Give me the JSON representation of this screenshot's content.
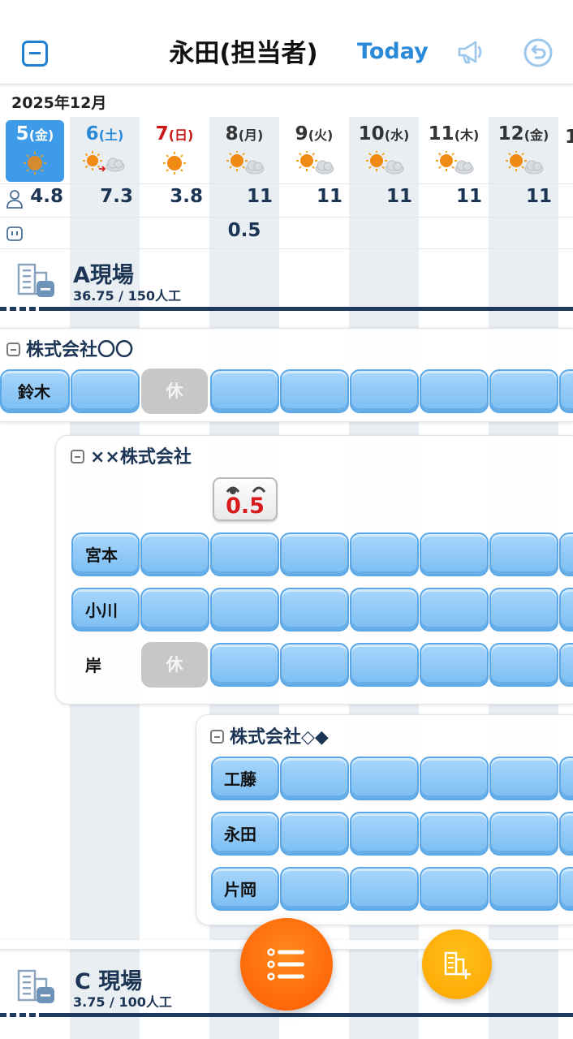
{
  "header": {
    "title": "永田(担当者)",
    "today_label": "Today",
    "collapse_icon": "minus-square-icon",
    "announce_icon": "megaphone-icon",
    "back_icon": "undo-icon"
  },
  "calendar": {
    "month": "2025年12月",
    "days": [
      {
        "num": "5",
        "dow": "(金)",
        "weather": "sunny",
        "workers": "4.8",
        "extra": "",
        "selected": true
      },
      {
        "num": "6",
        "dow": "(土)",
        "weather": "sunny-to-cloudy",
        "workers": "7.3",
        "extra": ""
      },
      {
        "num": "7",
        "dow": "(日)",
        "weather": "sunny",
        "workers": "3.8",
        "extra": ""
      },
      {
        "num": "8",
        "dow": "(月)",
        "weather": "sunny-cloudy",
        "workers": "11",
        "extra": "0.5"
      },
      {
        "num": "9",
        "dow": "(火)",
        "weather": "sunny-cloudy",
        "workers": "11",
        "extra": ""
      },
      {
        "num": "10",
        "dow": "(水)",
        "weather": "sunny-cloudy",
        "workers": "11",
        "extra": ""
      },
      {
        "num": "11",
        "dow": "(木)",
        "weather": "sunny-cloudy",
        "workers": "11",
        "extra": ""
      },
      {
        "num": "12",
        "dow": "(金)",
        "weather": "sunny-cloudy",
        "workers": "11",
        "extra": ""
      }
    ]
  },
  "sites": [
    {
      "name": "A現場",
      "stats": "36.75 /  150人工"
    },
    {
      "name": "C 現場",
      "stats": "3.75 /  100人工"
    }
  ],
  "companies": [
    {
      "name": "株式会社〇〇",
      "workers": [
        "鈴木"
      ]
    },
    {
      "name": "××株式会社",
      "counter": "0.5",
      "workers": [
        "宮本",
        "小川",
        "岸"
      ]
    },
    {
      "name": "株式会社◇◆",
      "workers": [
        "工藤",
        "永田",
        "片岡"
      ]
    }
  ],
  "off_label": "休",
  "colors": {
    "accent": "#2a8ad8",
    "sunday": "#c81818",
    "site_bar": "#1e3a5f",
    "fab": "#ff6a00",
    "fab_secondary": "#ffb000"
  }
}
